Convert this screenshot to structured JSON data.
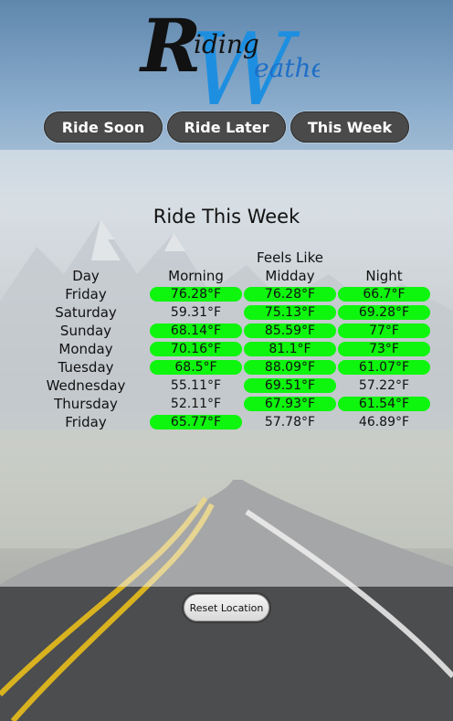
{
  "logo": {
    "text_main": "Riding",
    "text_accent": "Weather"
  },
  "nav": [
    {
      "label": "Ride Soon"
    },
    {
      "label": "Ride Later"
    },
    {
      "label": "This Week"
    }
  ],
  "forecast": {
    "title": "Ride This Week",
    "header_top": "Feels Like",
    "columns": [
      "Day",
      "Morning",
      "Midday",
      "Night"
    ],
    "good_color": "#0ef50e",
    "rows": [
      {
        "day": "Friday",
        "morning": "76.28°F",
        "midday": "76.28°F",
        "night": "66.7°F",
        "good": [
          true,
          true,
          true
        ]
      },
      {
        "day": "Saturday",
        "morning": "59.31°F",
        "midday": "75.13°F",
        "night": "69.28°F",
        "good": [
          false,
          true,
          true
        ]
      },
      {
        "day": "Sunday",
        "morning": "68.14°F",
        "midday": "85.59°F",
        "night": "77°F",
        "good": [
          true,
          true,
          true
        ]
      },
      {
        "day": "Monday",
        "morning": "70.16°F",
        "midday": "81.1°F",
        "night": "73°F",
        "good": [
          true,
          true,
          true
        ]
      },
      {
        "day": "Tuesday",
        "morning": "68.5°F",
        "midday": "88.09°F",
        "night": "61.07°F",
        "good": [
          true,
          true,
          true
        ]
      },
      {
        "day": "Wednesday",
        "morning": "55.11°F",
        "midday": "69.51°F",
        "night": "57.22°F",
        "good": [
          false,
          true,
          false
        ]
      },
      {
        "day": "Thursday",
        "morning": "52.11°F",
        "midday": "67.93°F",
        "night": "61.54°F",
        "good": [
          false,
          true,
          true
        ]
      },
      {
        "day": "Friday",
        "morning": "65.77°F",
        "midday": "57.78°F",
        "night": "46.89°F",
        "good": [
          true,
          false,
          false
        ]
      }
    ]
  },
  "reset_button": {
    "label": "Reset Location"
  }
}
